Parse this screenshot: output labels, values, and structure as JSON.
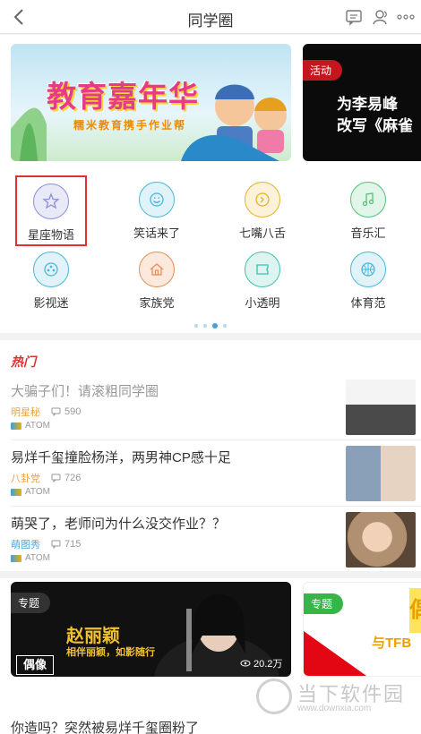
{
  "header": {
    "title": "同学圈"
  },
  "banners": {
    "main": {
      "headline": "教育嘉年华",
      "subline": "糯米教育携手作业帮"
    },
    "side": {
      "tag": "活动",
      "text_line1": "为李易峰",
      "text_line2": "改写《麻雀"
    }
  },
  "categories": [
    {
      "label": "星座物语",
      "icon": "star-icon",
      "color": "#8a8fd8",
      "bg": "#e9eaf8",
      "selected": true
    },
    {
      "label": "笑话来了",
      "icon": "smile-icon",
      "color": "#48b7d8",
      "bg": "#e1f3f9"
    },
    {
      "label": "七嘴八舌",
      "icon": "chat-icon",
      "color": "#e6b22e",
      "bg": "#fbf2d9"
    },
    {
      "label": "音乐汇",
      "icon": "music-icon",
      "color": "#55c07b",
      "bg": "#e2f5e9"
    },
    {
      "label": "影视迷",
      "icon": "film-icon",
      "color": "#48b7d8",
      "bg": "#e1f3f9"
    },
    {
      "label": "家族党",
      "icon": "house-icon",
      "color": "#e98c56",
      "bg": "#fbe9de"
    },
    {
      "label": "小透明",
      "icon": "ticket-icon",
      "color": "#3fc0b0",
      "bg": "#ddf4f1"
    },
    {
      "label": "体育范",
      "icon": "ball-icon",
      "color": "#48b7d8",
      "bg": "#e1f3f9"
    }
  ],
  "hot": {
    "header": "热门",
    "items": [
      {
        "title": "大骗子们！请滚粗同学圈",
        "tag": "明星秘",
        "tag_color": "#e8a23c",
        "comments": "590",
        "source": "ATOM"
      },
      {
        "title": "易烊千玺撞脸杨洋，两男神CP感十足",
        "tag": "八卦党",
        "tag_color": "#e8a23c",
        "comments": "726",
        "source": "ATOM"
      },
      {
        "title": "萌哭了，老师问为什么没交作业？？",
        "tag": "萌图秀",
        "tag_color": "#4aa8e0",
        "comments": "715",
        "source": "ATOM"
      }
    ]
  },
  "featured": {
    "left": {
      "tag": "专题",
      "name": "赵丽颖",
      "slogan": "相伴丽颖，如影随行",
      "brand": "偶像",
      "views": "20.2万"
    },
    "right": {
      "tag": "专题",
      "brand": "与TFB",
      "brand_side": "偶"
    }
  },
  "bottom": {
    "title": "你造吗？突然被易烊千玺圈粉了"
  },
  "watermark": {
    "text": "当下软件园",
    "url": "www.downxia.com"
  },
  "colors": {
    "accent_red": "#e0312f",
    "tag_dark": "#333333",
    "tag_red": "#c4161c",
    "tag_green": "#36b549"
  }
}
